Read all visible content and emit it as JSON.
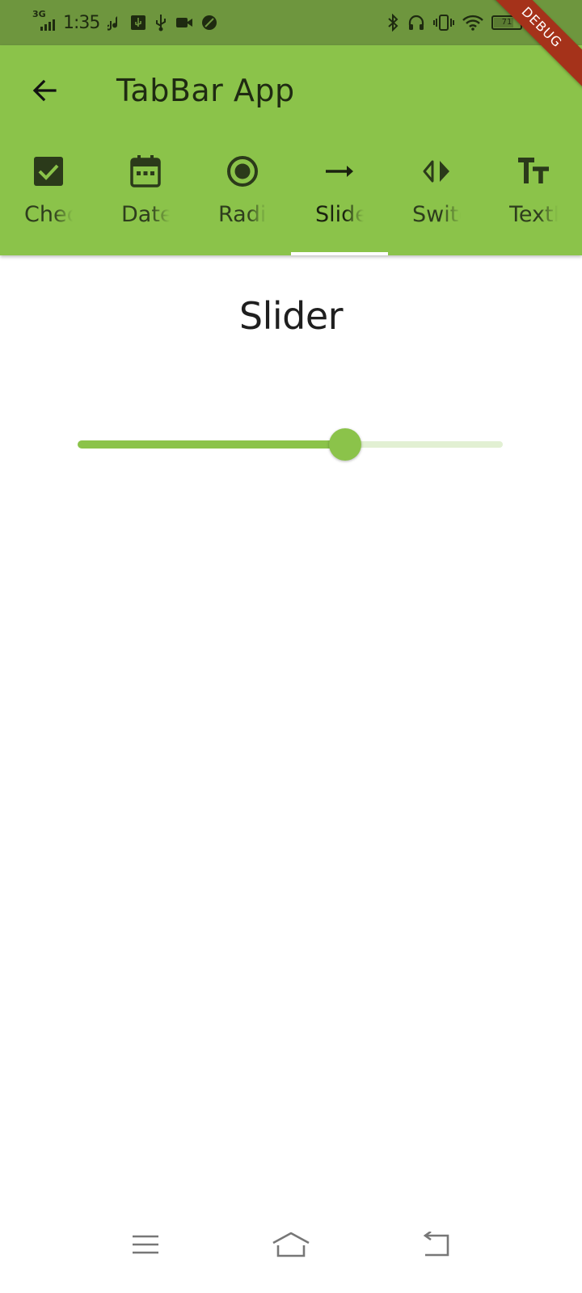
{
  "status_bar": {
    "network": "3G",
    "time": "1:35",
    "battery": "71"
  },
  "app_bar": {
    "title": "TabBar App",
    "tabs": [
      {
        "label": "Checkbox",
        "icon": "check-box-icon",
        "selected": false
      },
      {
        "label": "Date",
        "icon": "calendar-icon",
        "selected": false
      },
      {
        "label": "Radio",
        "icon": "radio-button-icon",
        "selected": false
      },
      {
        "label": "Slider",
        "icon": "arrow-right-icon",
        "selected": true
      },
      {
        "label": "Switch",
        "icon": "switch-arrows-icon",
        "selected": false
      },
      {
        "label": "TextField",
        "icon": "text-fields-icon",
        "selected": false
      }
    ]
  },
  "debug_banner": "DEBUG",
  "content": {
    "title": "Slider",
    "slider_value": 0.63
  },
  "colors": {
    "primary": "#8bc34a",
    "status_bar": "#6e963e",
    "slider_inactive": "#e2f0d3",
    "debug_banner": "#a5321a"
  }
}
